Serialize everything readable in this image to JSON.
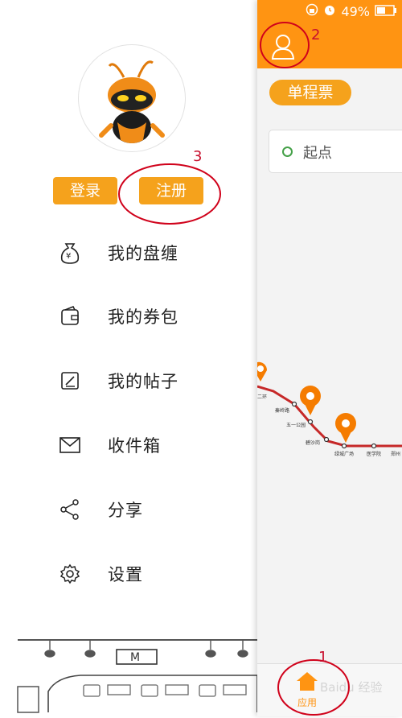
{
  "drawer": {
    "login_label": "登录",
    "register_label": "注册",
    "menu": [
      {
        "label": "我的盘缠",
        "icon": "money-bag-icon"
      },
      {
        "label": "我的券包",
        "icon": "wallet-icon"
      },
      {
        "label": "我的帖子",
        "icon": "edit-post-icon"
      },
      {
        "label": "收件箱",
        "icon": "mail-icon"
      },
      {
        "label": "分享",
        "icon": "share-icon"
      },
      {
        "label": "设置",
        "icon": "gear-icon"
      }
    ],
    "metro_sign": "M"
  },
  "panel": {
    "status": {
      "battery": "49%"
    },
    "tab_label": "单程票",
    "origin_placeholder": "起点",
    "stations": [
      "二环",
      "秦岭路",
      "五一公园",
      "碧沙岗",
      "绿城广场",
      "医学院",
      "郑州"
    ],
    "bottom_nav_label": "应用",
    "watermark": "Baidu 经验"
  },
  "annotations": [
    "1",
    "2",
    "3"
  ],
  "colors": {
    "orange": "#ff9412",
    "button": "#f5a21c",
    "annotation": "#c8102e",
    "metro_line": "#c62828"
  }
}
